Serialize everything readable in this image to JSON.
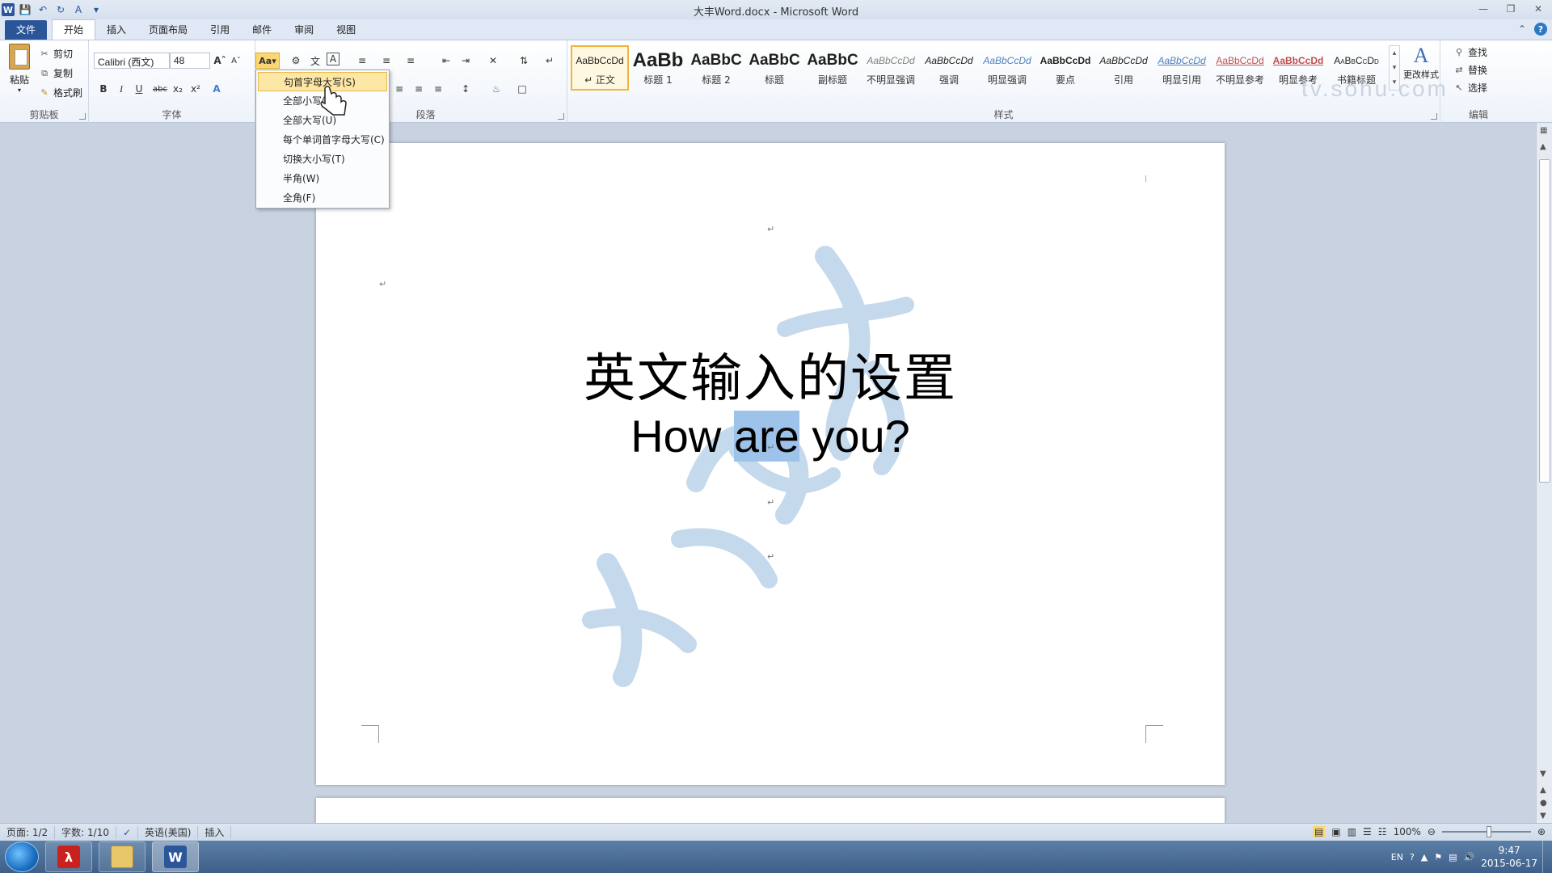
{
  "window": {
    "title": "大丰Word.docx - Microsoft Word"
  },
  "tabs": [
    {
      "label": "文件"
    },
    {
      "label": "开始"
    },
    {
      "label": "插入"
    },
    {
      "label": "页面布局"
    },
    {
      "label": "引用"
    },
    {
      "label": "邮件"
    },
    {
      "label": "审阅"
    },
    {
      "label": "视图"
    }
  ],
  "clipboard": {
    "paste": "粘贴",
    "cut": "剪切",
    "copy": "复制",
    "format_painter": "格式刷",
    "group_label": "剪贴板"
  },
  "font": {
    "name": "Calibri (西文)",
    "size": "48",
    "change_case_label": "Aa",
    "group_label": "字体"
  },
  "paragraph": {
    "group_label": "段落"
  },
  "styles": {
    "group_label": "样式",
    "items": [
      {
        "sample": "AaBbCcDd",
        "name": "↵ 正文"
      },
      {
        "sample": "AaBb",
        "name": "标题 1"
      },
      {
        "sample": "AaBbC",
        "name": "标题 2"
      },
      {
        "sample": "AaBbC",
        "name": "标题"
      },
      {
        "sample": "AaBbC",
        "name": "副标题"
      },
      {
        "sample": "AaBbCcDd",
        "name": "不明显强调"
      },
      {
        "sample": "AaBbCcDd",
        "name": "强调"
      },
      {
        "sample": "AaBbCcDd",
        "name": "明显强调"
      },
      {
        "sample": "AaBbCcDd",
        "name": "要点"
      },
      {
        "sample": "AaBbCcDd",
        "name": "引用"
      },
      {
        "sample": "AaBbCcDd",
        "name": "明显引用"
      },
      {
        "sample": "AaBbCcDd",
        "name": "不明显参考"
      },
      {
        "sample": "AaBbCcDd",
        "name": "明显参考"
      },
      {
        "sample": "AaBbCcDd",
        "name": "书籍标题"
      }
    ],
    "change_styles": "更改样式"
  },
  "editing": {
    "find": "查找",
    "replace": "替换",
    "select": "选择",
    "group_label": "编辑"
  },
  "change_case_menu": [
    {
      "label": "句首字母大写(S)",
      "highlighted": true
    },
    {
      "label": "全部小写(L)"
    },
    {
      "label": "全部大写(U)"
    },
    {
      "label": "每个单词首字母大写(C)"
    },
    {
      "label": "切换大小写(T)"
    },
    {
      "label": "半角(W)"
    },
    {
      "label": "全角(F)"
    }
  ],
  "document": {
    "heading_cn": "英文输入的设置",
    "line_before": "How ",
    "selected_word": "are",
    "line_after": " you?",
    "para_mark": "↵"
  },
  "status": {
    "page": "页面: 1/2",
    "words": "字数: 1/10",
    "language": "英语(美国)",
    "mode": "插入",
    "zoom": "100%",
    "zoom_fraction": 0.5
  },
  "taskbar": {
    "time": "9:47",
    "date": "2015-06-17",
    "input_lang": "EN"
  },
  "watermark_logo_text": "tv.sohu.com",
  "colors": {
    "file_tab": "#2a5699",
    "selection": "#9ec3ea",
    "menu_highlight": "#fde7a5"
  }
}
